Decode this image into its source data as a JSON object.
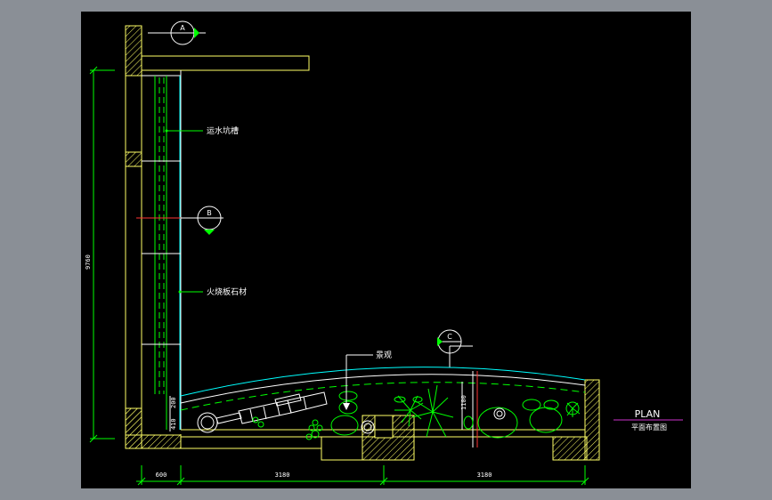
{
  "drawing": {
    "plan_title": "PLAN",
    "plan_subtitle": "平面布置图",
    "callouts": {
      "drain": "运水坑槽",
      "stone": "火烧板石材",
      "landscape": "景观"
    },
    "markers": {
      "a": "A",
      "b": "B",
      "c": "C"
    },
    "dimensions": {
      "height_total": "9760",
      "bottom_left": "600",
      "bottom_mid": "3180",
      "bottom_right": "3180",
      "small_200": "200",
      "small_410": "410",
      "small_1100": "1100"
    },
    "colors": {
      "background": "#000000",
      "frame": "#8a8f96",
      "wall": "#ffff66",
      "hatch": "#ffff66",
      "plant": "#00ff00",
      "water_line": "#00ffff",
      "red": "#ff3333",
      "title_underline": "#cc33cc"
    }
  }
}
